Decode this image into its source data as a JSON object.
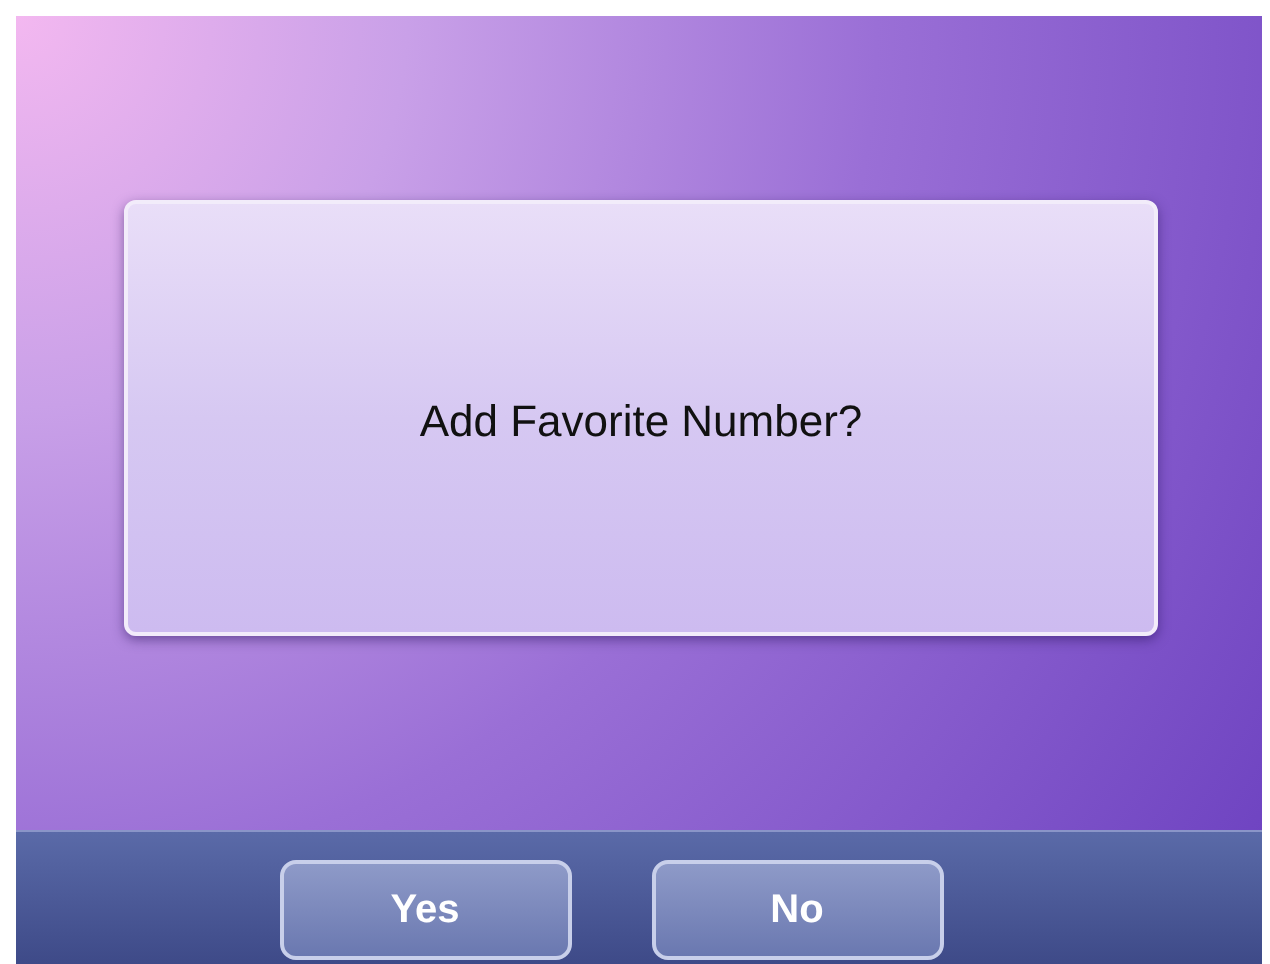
{
  "dialog": {
    "message": "Add Favorite Number?"
  },
  "buttons": [
    {
      "label": "Yes"
    },
    {
      "label": "No"
    }
  ]
}
